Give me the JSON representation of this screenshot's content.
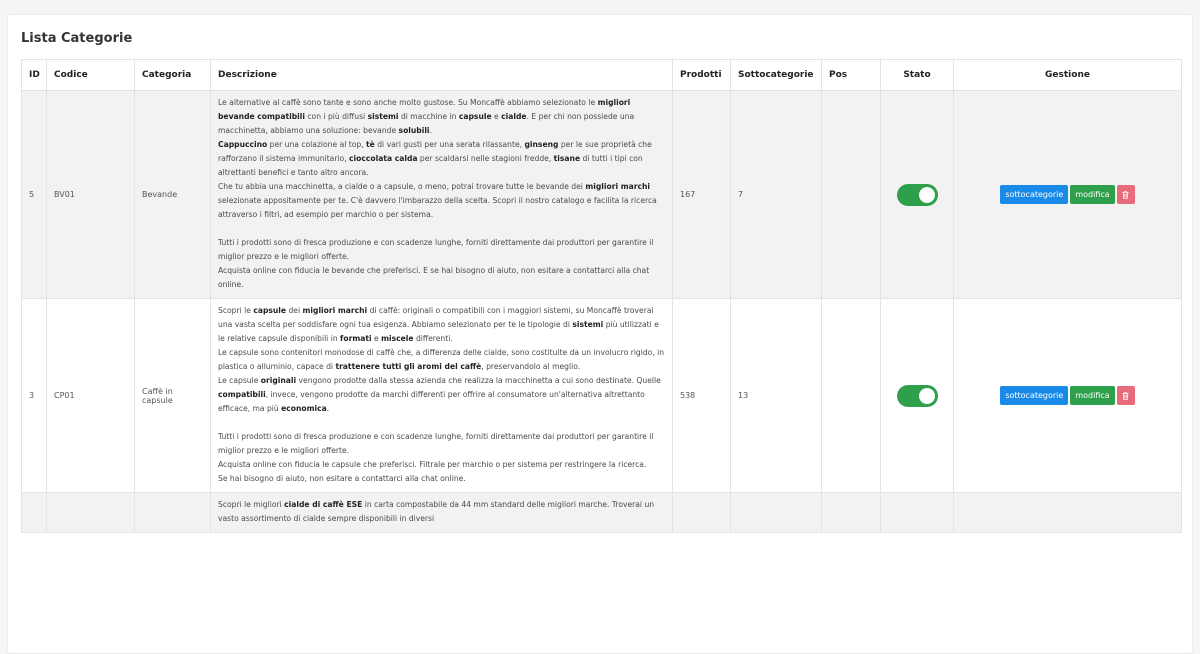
{
  "card": {
    "title": "Lista Categorie"
  },
  "headers": {
    "id": "ID",
    "code": "Codice",
    "category": "Categoria",
    "description": "Descrizione",
    "products": "Prodotti",
    "subcategories": "Sottocategorie",
    "pos": "Pos",
    "status": "Stato",
    "manage": "Gestione"
  },
  "rows": [
    {
      "id": "5",
      "code": "BV01",
      "category": "Bevande",
      "description": [
        [
          [
            "Le alternative al caffè sono tante e sono anche molto gustose. Su Moncaffè abbiamo selezionato le ",
            0
          ],
          [
            "migliori bevande compatibili",
            1
          ],
          [
            " con i più diffusi ",
            0
          ],
          [
            "sistemi",
            1
          ],
          [
            " di macchine in ",
            0
          ],
          [
            "capsule",
            1
          ],
          [
            " e ",
            0
          ],
          [
            "cialde",
            1
          ],
          [
            ". E per chi non possiede una macchinetta, abbiamo una soluzione: bevande ",
            0
          ],
          [
            "solubili",
            1
          ],
          [
            ".",
            0
          ]
        ],
        [
          [
            "Cappuccino",
            1
          ],
          [
            " per una colazione al top, ",
            0
          ],
          [
            "tè",
            1
          ],
          [
            " di vari gusti per una serata rilassante, ",
            0
          ],
          [
            "ginseng",
            1
          ],
          [
            " per le sue proprietà che rafforzano il sistema immunitario, ",
            0
          ],
          [
            "cioccolata calda",
            1
          ],
          [
            " per scaldarsi nelle stagioni fredde, ",
            0
          ],
          [
            "tisane",
            1
          ],
          [
            " di tutti i tipi con altrettanti benefici e tanto altro ancora.",
            0
          ]
        ],
        [
          [
            "Che tu abbia una macchinetta, a cialde o a capsule, o meno, potrai trovare tutte le bevande dei ",
            0
          ],
          [
            "migliori marchi",
            1
          ],
          [
            " selezionate appositamente per te. C'è davvero l'imbarazzo della scelta. Scopri il nostro catalogo e facilita la ricerca attraverso i filtri, ad esempio per marchio o per sistema.",
            0
          ]
        ],
        [
          [
            "",
            0
          ]
        ],
        [
          [
            "Tutti i prodotti sono di fresca produzione e con scadenze lunghe, forniti direttamente dai produttori per garantire il miglior prezzo e le migliori offerte.",
            0
          ]
        ],
        [
          [
            "Acquista online con fiducia le bevande che preferisci. E se hai bisogno di aiuto, non esitare a contattarci alla chat online.",
            0
          ]
        ]
      ],
      "products": "167",
      "subcategories": "7",
      "pos": "",
      "status_on": true,
      "btn_sub": "sottocategorie",
      "btn_edit": "modifica"
    },
    {
      "id": "3",
      "code": "CP01",
      "category": "Caffè in capsule",
      "description": [
        [
          [
            "Scopri le ",
            0
          ],
          [
            "capsule",
            1
          ],
          [
            " dei ",
            0
          ],
          [
            "migliori marchi",
            1
          ],
          [
            " di caffè: originali o compatibili con i maggiori sistemi, su Moncaffè troverai una vasta scelta per soddisfare ogni tua esigenza. Abbiamo selezionato per te le tipologie di ",
            0
          ],
          [
            "sistemi",
            1
          ],
          [
            " più utilizzati e le relative capsule disponibili in ",
            0
          ],
          [
            "formati",
            1
          ],
          [
            " e ",
            0
          ],
          [
            "miscele",
            1
          ],
          [
            " differenti.",
            0
          ]
        ],
        [
          [
            "Le capsule sono contenitori monodose di caffè che, a differenza delle cialde, sono costituite da un involucro rigido, in plastica o alluminio, capace di ",
            0
          ],
          [
            "trattenere tutti gli aromi del caffè",
            1
          ],
          [
            ", preservandolo al meglio.",
            0
          ]
        ],
        [
          [
            "Le capsule ",
            0
          ],
          [
            "originali",
            1
          ],
          [
            " vengono prodotte dalla stessa azienda che realizza la macchinetta a cui sono destinate. Quelle ",
            0
          ],
          [
            "compatibili",
            1
          ],
          [
            ", invece, vengono prodotte da marchi differenti per offrire al consumatore un'alternativa altrettanto efficace, ma più ",
            0
          ],
          [
            "economica",
            1
          ],
          [
            ".",
            0
          ]
        ],
        [
          [
            "",
            0
          ]
        ],
        [
          [
            "Tutti i prodotti sono di fresca produzione e con scadenze lunghe, forniti direttamente dai produttori per garantire il miglior prezzo e le migliori offerte.",
            0
          ]
        ],
        [
          [
            "Acquista online con fiducia le capsule che preferisci. Filtrale per marchio o per sistema per restringere la ricerca.",
            0
          ]
        ],
        [
          [
            "Se hai bisogno di aiuto, non esitare a contattarci alla chat online.",
            0
          ]
        ]
      ],
      "products": "538",
      "subcategories": "13",
      "pos": "",
      "status_on": true,
      "btn_sub": "sottocategorie",
      "btn_edit": "modifica"
    },
    {
      "id": "",
      "code": "",
      "category": "",
      "description": [
        [
          [
            "Scopri le migliori ",
            0
          ],
          [
            "cialde di caffè ESE",
            1
          ],
          [
            " in carta compostabile da 44 mm standard delle migliori marche. Troverai un vasto assortimento di cialde sempre disponibili in diversi",
            0
          ]
        ]
      ],
      "products": "",
      "subcategories": "",
      "pos": "",
      "status_on": false,
      "btn_sub": "",
      "btn_edit": ""
    }
  ],
  "icons": {
    "delete": "trash-icon"
  },
  "colors": {
    "primary": "#1a8ae8",
    "success": "#2e9f4a",
    "danger": "#e76b7b"
  }
}
